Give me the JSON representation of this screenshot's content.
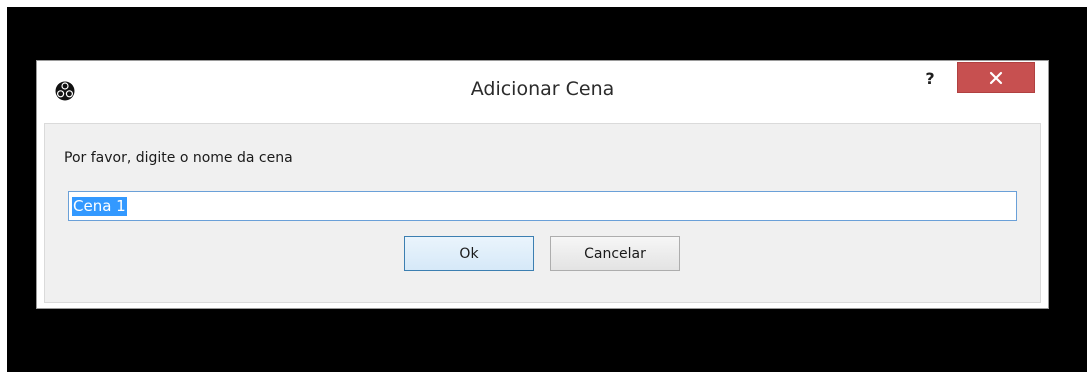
{
  "dialog": {
    "title": "Adicionar Cena",
    "help_label": "?",
    "prompt": "Por favor, digite o nome da cena",
    "input_value": "Cena 1",
    "ok_label": "Ok",
    "cancel_label": "Cancelar"
  },
  "icons": {
    "app": "obs-logo-icon",
    "close": "close-icon"
  },
  "colors": {
    "close_button": "#c75050",
    "selection": "#3399ff",
    "input_focus_border": "#6aa0d8"
  }
}
